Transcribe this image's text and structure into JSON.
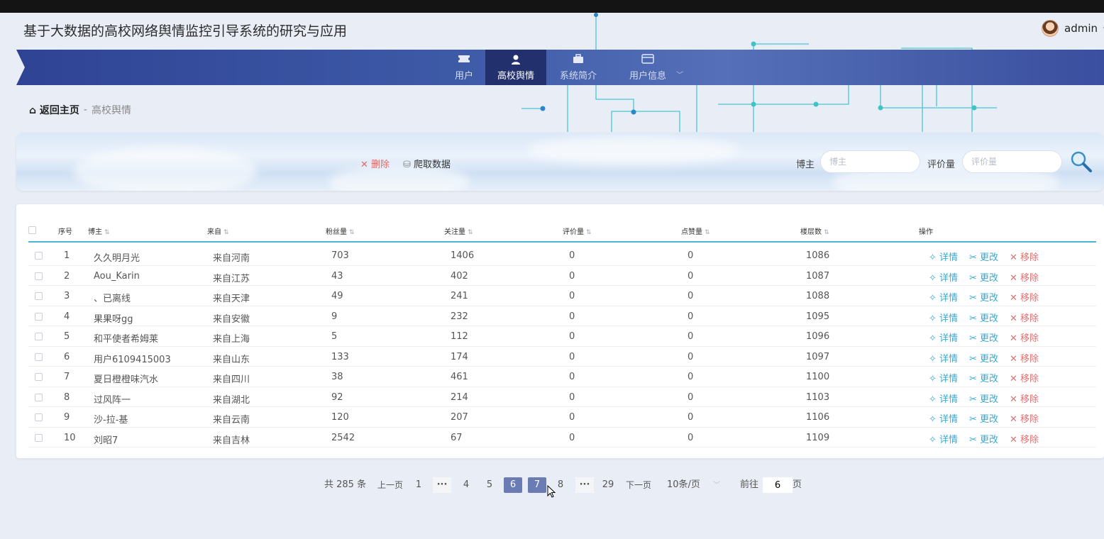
{
  "app": {
    "title": "基于大数据的高校网络舆情监控引导系统的研究与应用",
    "user": "admin"
  },
  "nav": {
    "items": [
      {
        "label": "用户",
        "icon": "ticket-icon"
      },
      {
        "label": "高校舆情",
        "icon": "user-icon",
        "active": true
      },
      {
        "label": "系统简介",
        "icon": "briefcase-icon"
      },
      {
        "label": "用户信息",
        "icon": "card-icon"
      }
    ]
  },
  "breadcrumb": {
    "home": "返回主页",
    "sep": "-",
    "current": "高校舆情"
  },
  "toolbar": {
    "delete_label": "删除",
    "crawl_label": "爬取数据"
  },
  "search": {
    "blogger_label": "博主",
    "blogger_placeholder": "博主",
    "comments_label": "评价量",
    "comments_placeholder": "评价量"
  },
  "table": {
    "headers": [
      "序号",
      "博主",
      "来自",
      "粉丝量",
      "关注量",
      "评价量",
      "点赞量",
      "楼层数",
      "操作"
    ],
    "actions": {
      "detail": "详情",
      "edit": "更改",
      "remove": "移除"
    },
    "rows": [
      {
        "no": "1",
        "blogger": "久久明月光",
        "from": "来自河南",
        "fans": "703",
        "follow": "1406",
        "comments": "0",
        "likes": "0",
        "floor": "1086"
      },
      {
        "no": "2",
        "blogger": "Aou_Karin",
        "from": "来自江苏",
        "fans": "43",
        "follow": "402",
        "comments": "0",
        "likes": "0",
        "floor": "1087"
      },
      {
        "no": "3",
        "blogger": "、已离线",
        "from": "来自天津",
        "fans": "49",
        "follow": "241",
        "comments": "0",
        "likes": "0",
        "floor": "1088"
      },
      {
        "no": "4",
        "blogger": "果果呀gg",
        "from": "来自安徽",
        "fans": "9",
        "follow": "232",
        "comments": "0",
        "likes": "0",
        "floor": "1095"
      },
      {
        "no": "5",
        "blogger": "和平使者希姆莱",
        "from": "来自上海",
        "fans": "5",
        "follow": "112",
        "comments": "0",
        "likes": "0",
        "floor": "1096"
      },
      {
        "no": "6",
        "blogger": "用户6109415003",
        "from": "来自山东",
        "fans": "133",
        "follow": "174",
        "comments": "0",
        "likes": "0",
        "floor": "1097"
      },
      {
        "no": "7",
        "blogger": "夏日橙橙味汽水",
        "from": "来自四川",
        "fans": "38",
        "follow": "461",
        "comments": "0",
        "likes": "0",
        "floor": "1100"
      },
      {
        "no": "8",
        "blogger": "过风阵一",
        "from": "来自湖北",
        "fans": "92",
        "follow": "214",
        "comments": "0",
        "likes": "0",
        "floor": "1103"
      },
      {
        "no": "9",
        "blogger": "沙-拉-基",
        "from": "来自云南",
        "fans": "120",
        "follow": "207",
        "comments": "0",
        "likes": "0",
        "floor": "1106"
      },
      {
        "no": "10",
        "blogger": "刘昭7",
        "from": "来自吉林",
        "fans": "2542",
        "follow": "67",
        "comments": "0",
        "likes": "0",
        "floor": "1109"
      }
    ]
  },
  "pager": {
    "total": "共 285 条",
    "prev": "上一页",
    "next": "下一页",
    "pages": [
      "1",
      "4",
      "5",
      "6",
      "7",
      "8",
      "29"
    ],
    "more": "···",
    "current": "6",
    "hover": "7",
    "page_size": "10条/页",
    "goto_prefix": "前往",
    "goto_value": "6",
    "goto_suffix": "页"
  },
  "colors": {
    "nav": "#3d5aa7",
    "nav_active": "#22306d",
    "accent": "#39a8cf",
    "danger": "#e36f6f",
    "page_active": "#6b7bb4"
  }
}
